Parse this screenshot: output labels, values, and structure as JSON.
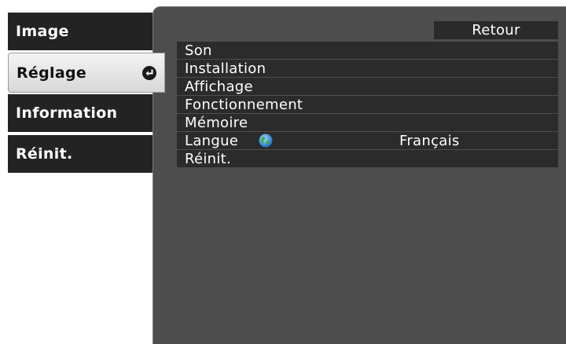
{
  "sidebar": {
    "tabs": [
      {
        "label": "Image"
      },
      {
        "label": "Réglage",
        "active": true
      },
      {
        "label": "Information"
      },
      {
        "label": "Réinit."
      }
    ]
  },
  "main": {
    "back_label": "Retour",
    "items": [
      {
        "label": "Son"
      },
      {
        "label": "Installation"
      },
      {
        "label": "Affichage"
      },
      {
        "label": "Fonctionnement"
      },
      {
        "label": "Mémoire"
      },
      {
        "label": "Langue",
        "icon": "globe-icon",
        "value": "Français"
      },
      {
        "label": "Réinit."
      }
    ]
  },
  "colors": {
    "panel_bg": "#4e4e4e",
    "row_bg": "#2b2b2b",
    "tab_bg": "#232323",
    "active_tab_bg": "#e6e6e6"
  }
}
